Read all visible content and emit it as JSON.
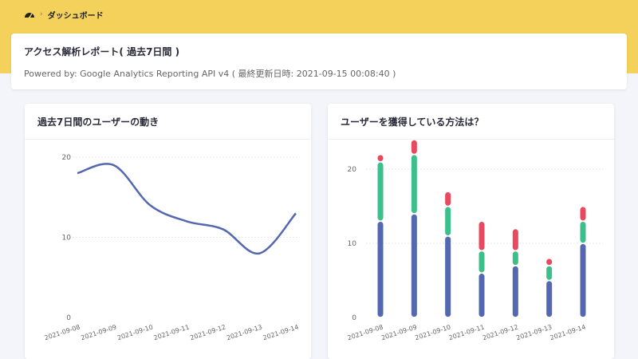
{
  "breadcrumb": {
    "home_icon": "dashboard-icon",
    "separator": "›",
    "current": "ダッシュボード"
  },
  "report": {
    "title": "アクセス解析レポート( 過去7日間 )",
    "subtitle": "Powered by: Google Analytics Reporting API v4 ( 最終更新日時: 2021-09-15 00:08:40 )"
  },
  "colors": {
    "band": "#f3d15a",
    "line": "#5468b0",
    "blue": "#5468b0",
    "green": "#3cbf8a",
    "red": "#e8495e"
  },
  "left_chart": {
    "title": "過去7日間のユーザーの動き"
  },
  "right_chart": {
    "title": "ユーザーを獲得している方法は？"
  },
  "chart_data": [
    {
      "type": "line",
      "title": "過去7日間のユーザーの動き",
      "x": [
        "2021-09-08",
        "2021-09-09",
        "2021-09-10",
        "2021-09-11",
        "2021-09-12",
        "2021-09-13",
        "2021-09-14"
      ],
      "series": [
        {
          "values": [
            18,
            19,
            14,
            12,
            11,
            8,
            13
          ]
        }
      ],
      "yticks": [
        0,
        10,
        20
      ],
      "ylim": [
        0,
        20
      ],
      "grid": true
    },
    {
      "type": "bar",
      "stacked": true,
      "title": "ユーザーを獲得している方法は？",
      "categories": [
        "2021-09-08",
        "2021-09-09",
        "2021-09-10",
        "2021-09-11",
        "2021-09-12",
        "2021-09-13",
        "2021-09-14"
      ],
      "series": [
        {
          "color": "#5468b0",
          "values": [
            13,
            14,
            11,
            6,
            7,
            5,
            10
          ]
        },
        {
          "color": "#3cbf8a",
          "values": [
            8,
            8,
            4,
            3,
            2,
            2,
            3
          ]
        },
        {
          "color": "#e8495e",
          "values": [
            1,
            2,
            2,
            4,
            3,
            1,
            2
          ]
        }
      ],
      "yticks": [
        0,
        10,
        20
      ],
      "ylim": [
        0,
        24
      ],
      "grid": true
    }
  ]
}
